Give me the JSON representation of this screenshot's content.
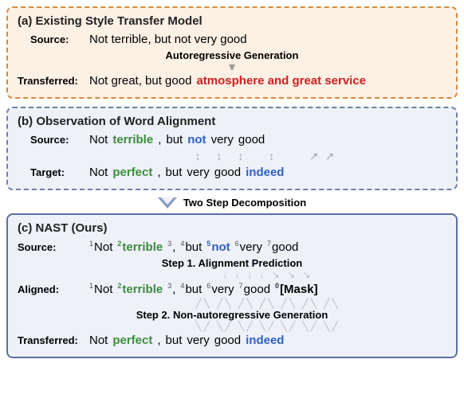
{
  "panel_a": {
    "title": "(a) Existing Style Transfer Model",
    "source_label": "Source:",
    "source_text": "Not terrible, but not very good",
    "gen_label": "Autoregressive Generation",
    "transferred_label": "Transferred:",
    "transferred_prefix": "Not great, but good",
    "transferred_emph": "atmosphere and great service"
  },
  "panel_b": {
    "title": "(b) Observation of Word Alignment",
    "source_label": "Source:",
    "src": {
      "w1": "Not",
      "w2": "terrible",
      "w3": ",",
      "w4": "but",
      "w5": "not",
      "w6": "very",
      "w7": "good"
    },
    "target_label": "Target:",
    "tgt": {
      "w1": "Not",
      "w2": "perfect",
      "w3": ",",
      "w4": "but",
      "w5": "very",
      "w6": "good",
      "w7": "indeed"
    }
  },
  "between_label": "Two Step Decomposition",
  "panel_c": {
    "title": "(c) NAST (Ours)",
    "source_label": "Source:",
    "src": {
      "s1": "1",
      "w1": "Not",
      "s2": "2",
      "w2": "terrible",
      "s3": "3",
      "w3": ",",
      "s4": "4",
      "w4": "but",
      "s5": "5",
      "w5": "not",
      "s6": "6",
      "w6": "very",
      "s7": "7",
      "w7": "good"
    },
    "step1_label": "Step 1. Alignment Prediction",
    "aligned_label": "Aligned:",
    "aln": {
      "s1": "1",
      "w1": "Not",
      "s2": "2",
      "w2": "terrible",
      "s3": "3",
      "w3": ",",
      "s4": "4",
      "w4": "but",
      "s5": "6",
      "w5": "very",
      "s6": "7",
      "w6": "good",
      "s7": "0",
      "w7": "[Mask]"
    },
    "step2_label": "Step 2. Non-autoregressive Generation",
    "transferred_label": "Transferred:",
    "tgt": {
      "w1": "Not",
      "w2": "perfect",
      "w3": ",",
      "w4": "but",
      "w5": "very",
      "w6": "good",
      "w7": "indeed"
    }
  }
}
